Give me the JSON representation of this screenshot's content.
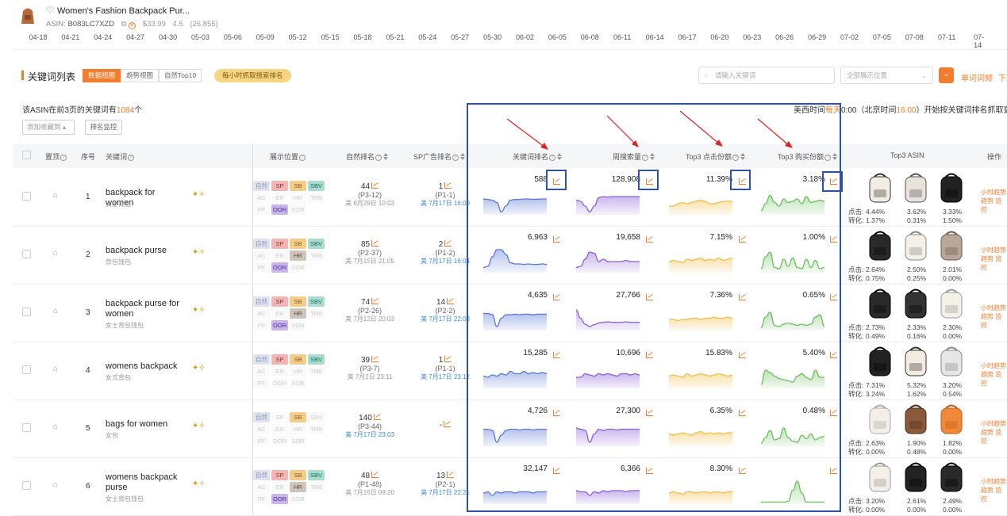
{
  "product": {
    "title": "Women's Fashion Backpack Pur...",
    "asin_label": "ASIN:",
    "asin": "B083LC7XZD",
    "price": "$33.99",
    "rating": "4.5",
    "reviews": "(26,855)"
  },
  "timeline_dates": [
    "04-18",
    "04-21",
    "04-24",
    "04-27",
    "04-30",
    "05-03",
    "05-06",
    "05-09",
    "05-12",
    "05-15",
    "05-18",
    "05-21",
    "05-24",
    "05-27",
    "05-30",
    "06-02",
    "06-05",
    "06-08",
    "06-11",
    "06-14",
    "06-17",
    "06-20",
    "06-23",
    "06-26",
    "06-29",
    "07-02",
    "07-05",
    "07-08",
    "07-11",
    "07-14"
  ],
  "toolbar": {
    "section_title": "关键词列表",
    "views": [
      "数据视图",
      "趋势视图",
      "自然Top10"
    ],
    "hourly_pill": "每小时抓取搜索排名",
    "search_placeholder": "请输入关键词",
    "position_select": "全部展示位置",
    "link1": "单词词频",
    "link2": "下"
  },
  "summary": {
    "prefix": "该ASIN在前3页的关键词有",
    "count": "1084",
    "suffix": "个",
    "time_a": "美西时间",
    "time_b": "每天",
    "time_c": "0:00（北京时间",
    "time_d": "16:00",
    "time_e": "）开始按关键词排名抓取更",
    "add_favorite": "添加收藏到",
    "rank_monitor": "排名监控"
  },
  "headers": {
    "pin": "置顶",
    "idx": "序号",
    "keyword": "关键词",
    "position": "展示位置",
    "natural": "自然排名",
    "sp": "SP广告排名",
    "kwrank": "关键词排名",
    "search_vol": "周搜索量",
    "click_share": "Top3 点击份额",
    "buy_share": "Top3 购买份额",
    "top3": "Top3 ASIN",
    "ops": "操作"
  },
  "badge_labels": [
    "自然",
    "SP",
    "SB",
    "SBV",
    "AC",
    "ER",
    "HR",
    "TRB",
    "PF",
    "OOR",
    "SOR"
  ],
  "row_labels": {
    "click": "点击:",
    "conv": "转化:",
    "op1": "小时趋势",
    "op2": "趋势",
    "op3": "监控"
  },
  "rows": [
    {
      "idx": "1",
      "kw": "backpack for women",
      "zh": "女士背包",
      "nat": "44",
      "natsub": "(P3-12)",
      "nattm": "美 6月29日 10:03",
      "sp": "1",
      "spsub": "(P1-1)",
      "sptm": "美 7月17日 16:00",
      "kwrank": "588",
      "vol": "128,908",
      "click": "11.39%",
      "buy": "3.18%",
      "a1": "4.44%",
      "a2": "3.62%",
      "a3": "3.33%",
      "c1": "1.37%",
      "c2": "0.31%",
      "c3": "1.50%"
    },
    {
      "idx": "2",
      "kw": "backpack purse",
      "zh": "背包钱包",
      "nat": "85",
      "natsub": "(P2-37)",
      "nattm": "美 7月15日 21:05",
      "sp": "2",
      "spsub": "(P1-2)",
      "sptm": "美 7月17日 16:04",
      "kwrank": "6,963",
      "vol": "19,658",
      "click": "7.15%",
      "buy": "1.00%",
      "a1": "2.64%",
      "a2": "2.50%",
      "a3": "2.01%",
      "c1": "0.75%",
      "c2": "0.25%",
      "c3": "0.00%"
    },
    {
      "idx": "3",
      "kw": "backpack purse for women",
      "zh": "女士背包钱包",
      "nat": "74",
      "natsub": "(P2-26)",
      "nattm": "美 7月12日 20:03",
      "sp": "14",
      "spsub": "(P2-2)",
      "sptm": "美 7月17日 22:03",
      "kwrank": "4,635",
      "vol": "27,766",
      "click": "7.36%",
      "buy": "0.65%",
      "a1": "2.73%",
      "a2": "2.33%",
      "a3": "2.30%",
      "c1": "0.49%",
      "c2": "0.16%",
      "c3": "0.00%"
    },
    {
      "idx": "4",
      "kw": "womens backpack",
      "zh": "女式背包",
      "nat": "39",
      "natsub": "(P3-7)",
      "nattm": "美 7月2日 23:11",
      "sp": "1",
      "spsub": "(P1-1)",
      "sptm": "美 7月17日 23:12",
      "kwrank": "15,285",
      "vol": "10,696",
      "click": "15.83%",
      "buy": "5.40%",
      "a1": "7.31%",
      "a2": "5.32%",
      "a3": "3.20%",
      "c1": "3.24%",
      "c2": "1.62%",
      "c3": "0.54%"
    },
    {
      "idx": "5",
      "kw": "bags for women",
      "zh": "女包",
      "nat": "140",
      "natsub": "(P3-44)",
      "nattm": "美 7月17日 23:03",
      "sp": "-",
      "spsub": "",
      "sptm": "",
      "kwrank": "4,726",
      "vol": "27,300",
      "click": "6.35%",
      "buy": "0.48%",
      "a1": "2.63%",
      "a2": "1.90%",
      "a3": "1.82%",
      "c1": "0.00%",
      "c2": "0.48%",
      "c3": "0.00%"
    },
    {
      "idx": "6",
      "kw": "womens backpack purse",
      "zh": "女士背包钱包",
      "nat": "48",
      "natsub": "(P1-48)",
      "nattm": "美 7月15日 09:20",
      "sp": "13",
      "spsub": "(P2-1)",
      "sptm": "美 7月17日 22:21",
      "kwrank": "32,147",
      "vol": "6,366",
      "click": "8.30%",
      "buy": "",
      "a1": "3.20%",
      "a2": "2.61%",
      "a3": "2.49%",
      "c1": "0.00%",
      "c2": "0.00%",
      "c3": "0.00%"
    }
  ],
  "colors": {
    "accent": "#f57c2c",
    "annotation_blue": "#2f52a8",
    "arrow_red": "#e02020",
    "spark_rank": "#5b78d6",
    "spark_vol": "#8a5fd9",
    "spark_click": "#f1bd45",
    "spark_buy": "#6bbf5c"
  }
}
